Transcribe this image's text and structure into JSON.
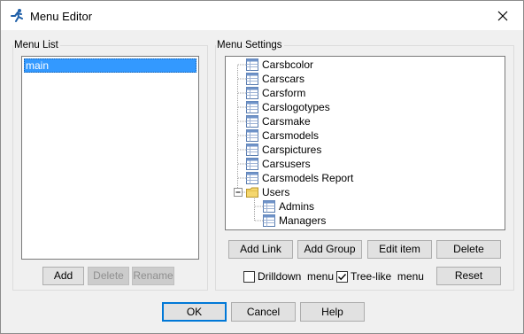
{
  "window": {
    "title": "Menu Editor",
    "close_icon": "close-icon",
    "app_icon": "runner-icon"
  },
  "menu_list": {
    "label": "Menu List",
    "items": [
      "main"
    ],
    "selected": "main",
    "buttons": {
      "add": "Add",
      "delete": "Delete",
      "rename": "Rename"
    }
  },
  "menu_settings": {
    "label": "Menu Settings",
    "tree": {
      "items": [
        "Carsbcolor",
        "Carscars",
        "Carsform",
        "Carslogotypes",
        "Carsmake",
        "Carsmodels",
        "Carspictures",
        "Carsusers",
        "Carsmodels Report"
      ],
      "group": {
        "label": "Users",
        "expanded": true,
        "children": [
          "Admins",
          "Managers"
        ]
      }
    },
    "buttons": {
      "add_link": "Add Link",
      "add_group": "Add Group",
      "edit_item": "Edit item",
      "delete": "Delete",
      "reset": "Reset"
    },
    "drilldown": {
      "label": "Drilldown  menu",
      "checked": false
    },
    "tree_like": {
      "label": "Tree-like  menu",
      "checked": true
    }
  },
  "footer": {
    "ok": "OK",
    "cancel": "Cancel",
    "help": "Help"
  },
  "colors": {
    "selection": "#3399ff",
    "dialog_bg": "#f0f0f0",
    "default_button_border": "#0078d7",
    "folder": "#f5d76e"
  }
}
